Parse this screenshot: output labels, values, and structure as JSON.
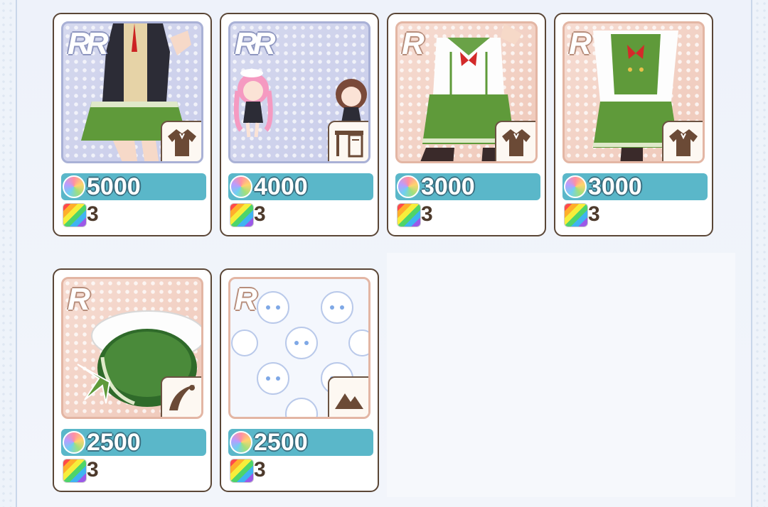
{
  "shop": {
    "items": [
      {
        "rarity": "RR",
        "category_icon": "shirt-icon",
        "price": "5000",
        "quantity": "3",
        "depicts": "character in black blazer and green skirt"
      },
      {
        "rarity": "RR",
        "category_icon": "furniture-icon",
        "price": "4000",
        "quantity": "3",
        "depicts": "two chibi characters"
      },
      {
        "rarity": "R",
        "category_icon": "shirt-icon",
        "price": "3000",
        "quantity": "3",
        "depicts": "sailor uniform with green skirt"
      },
      {
        "rarity": "R",
        "category_icon": "shirt-icon",
        "price": "3000",
        "quantity": "3",
        "depicts": "green vest uniform with skirt"
      },
      {
        "rarity": "R",
        "category_icon": "accessory-icon",
        "price": "2500",
        "quantity": "3",
        "depicts": "green sailor hat"
      },
      {
        "rarity": "R",
        "category_icon": "background-icon",
        "price": "2500",
        "quantity": "3",
        "depicts": "white bear pattern wallpaper"
      }
    ],
    "colors": {
      "price_bar": "#5ab7c9",
      "card_border": "#5a4636",
      "qty_text": "#4d3a2c"
    },
    "currency_icon": "rainbow-shell-icon",
    "quantity_icon": "rainbow-tile-icon"
  }
}
